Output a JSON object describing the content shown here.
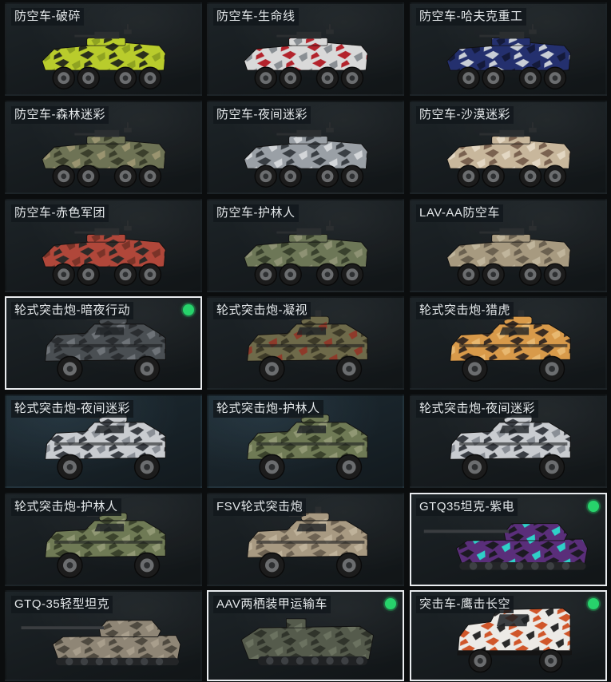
{
  "items": [
    {
      "label": "防空车-破碎",
      "type": "apc",
      "colors": [
        "#b9cc2c",
        "#2a2f1c",
        "#8fa321"
      ],
      "selected": false,
      "equipped": false,
      "bg": "dark"
    },
    {
      "label": "防空车-生命线",
      "type": "apc",
      "colors": [
        "#d9d9d9",
        "#b3232c",
        "#8a8f94"
      ],
      "selected": false,
      "equipped": false,
      "bg": "dark"
    },
    {
      "label": "防空车-哈夫克重工",
      "type": "apc",
      "colors": [
        "#24306e",
        "#c9ced6",
        "#141a3a"
      ],
      "selected": false,
      "equipped": false,
      "bg": "dark"
    },
    {
      "label": "防空车-森林迷彩",
      "type": "apc",
      "colors": [
        "#6e7355",
        "#3b3f2c",
        "#9a9470"
      ],
      "selected": false,
      "equipped": false,
      "bg": "dark"
    },
    {
      "label": "防空车-夜间迷彩",
      "type": "apc",
      "colors": [
        "#9aa0a6",
        "#3a3f44",
        "#d3d6d9"
      ],
      "selected": false,
      "equipped": false,
      "bg": "dark"
    },
    {
      "label": "防空车-沙漠迷彩",
      "type": "apc",
      "colors": [
        "#c8b79c",
        "#7a6250",
        "#e3d7c3"
      ],
      "selected": false,
      "equipped": false,
      "bg": "dark"
    },
    {
      "label": "防空车-赤色军团",
      "type": "apc",
      "colors": [
        "#b0473a",
        "#2e2a28",
        "#7a3328"
      ],
      "selected": false,
      "equipped": false,
      "bg": "dark"
    },
    {
      "label": "防空车-护林人",
      "type": "apc",
      "colors": [
        "#6d7757",
        "#39412d",
        "#8e9274"
      ],
      "selected": false,
      "equipped": false,
      "bg": "dark"
    },
    {
      "label": "LAV-AA防空车",
      "type": "apc",
      "colors": [
        "#a79a80",
        "#6b6150",
        "#c0b59c"
      ],
      "selected": false,
      "equipped": false,
      "bg": "dark"
    },
    {
      "label": "轮式突击炮-暗夜行动",
      "type": "mrap",
      "colors": [
        "#4a4f53",
        "#2a2d30",
        "#6e7378"
      ],
      "selected": true,
      "equipped": true,
      "bg": "dark"
    },
    {
      "label": "轮式突击炮-凝视",
      "type": "mrap",
      "colors": [
        "#6e6a4a",
        "#3d3a28",
        "#8e3a2a"
      ],
      "selected": false,
      "equipped": false,
      "bg": "dark"
    },
    {
      "label": "轮式突击炮-猎虎",
      "type": "mrap",
      "colors": [
        "#d89a4a",
        "#3a2c22",
        "#e8b870"
      ],
      "selected": false,
      "equipped": false,
      "bg": "dark"
    },
    {
      "label": "轮式突击炮-夜间迷彩",
      "type": "mrap",
      "colors": [
        "#c9ccd0",
        "#3a3e44",
        "#8a8f96"
      ],
      "selected": false,
      "equipped": false,
      "bg": "blue"
    },
    {
      "label": "轮式突击炮-护林人",
      "type": "mrap",
      "colors": [
        "#6f7a55",
        "#3b432c",
        "#919874"
      ],
      "selected": false,
      "equipped": false,
      "bg": "blue"
    },
    {
      "label": "轮式突击炮-夜间迷彩",
      "type": "mrap",
      "colors": [
        "#c9ccd0",
        "#3a3e44",
        "#8a8f96"
      ],
      "selected": false,
      "equipped": false,
      "bg": "dark"
    },
    {
      "label": "轮式突击炮-护林人",
      "type": "mrap",
      "colors": [
        "#6f7a55",
        "#3b432c",
        "#919874"
      ],
      "selected": false,
      "equipped": false,
      "bg": "dark"
    },
    {
      "label": "FSV轮式突击炮",
      "type": "mrap",
      "colors": [
        "#a89a82",
        "#6d6252",
        "#bfb29a"
      ],
      "selected": false,
      "equipped": false,
      "bg": "dark"
    },
    {
      "label": "GTQ35坦克-紫电",
      "type": "tank",
      "colors": [
        "#5a2e7a",
        "#1c1a22",
        "#2fd0c8"
      ],
      "selected": true,
      "equipped": true,
      "bg": "dark"
    },
    {
      "label": "GTQ-35轻型坦克",
      "type": "tank",
      "colors": [
        "#8f8676",
        "#4f4a40",
        "#a89e8c"
      ],
      "selected": false,
      "equipped": false,
      "bg": "dark"
    },
    {
      "label": "AAV两栖装甲运输车",
      "type": "amph",
      "colors": [
        "#555b4c",
        "#30342b",
        "#6b7260"
      ],
      "selected": true,
      "equipped": true,
      "bg": "dark"
    },
    {
      "label": "突击车-鹰击长空",
      "type": "truck",
      "colors": [
        "#eceae6",
        "#d0562a",
        "#2a2a2a"
      ],
      "selected": true,
      "equipped": true,
      "bg": "dark"
    }
  ]
}
